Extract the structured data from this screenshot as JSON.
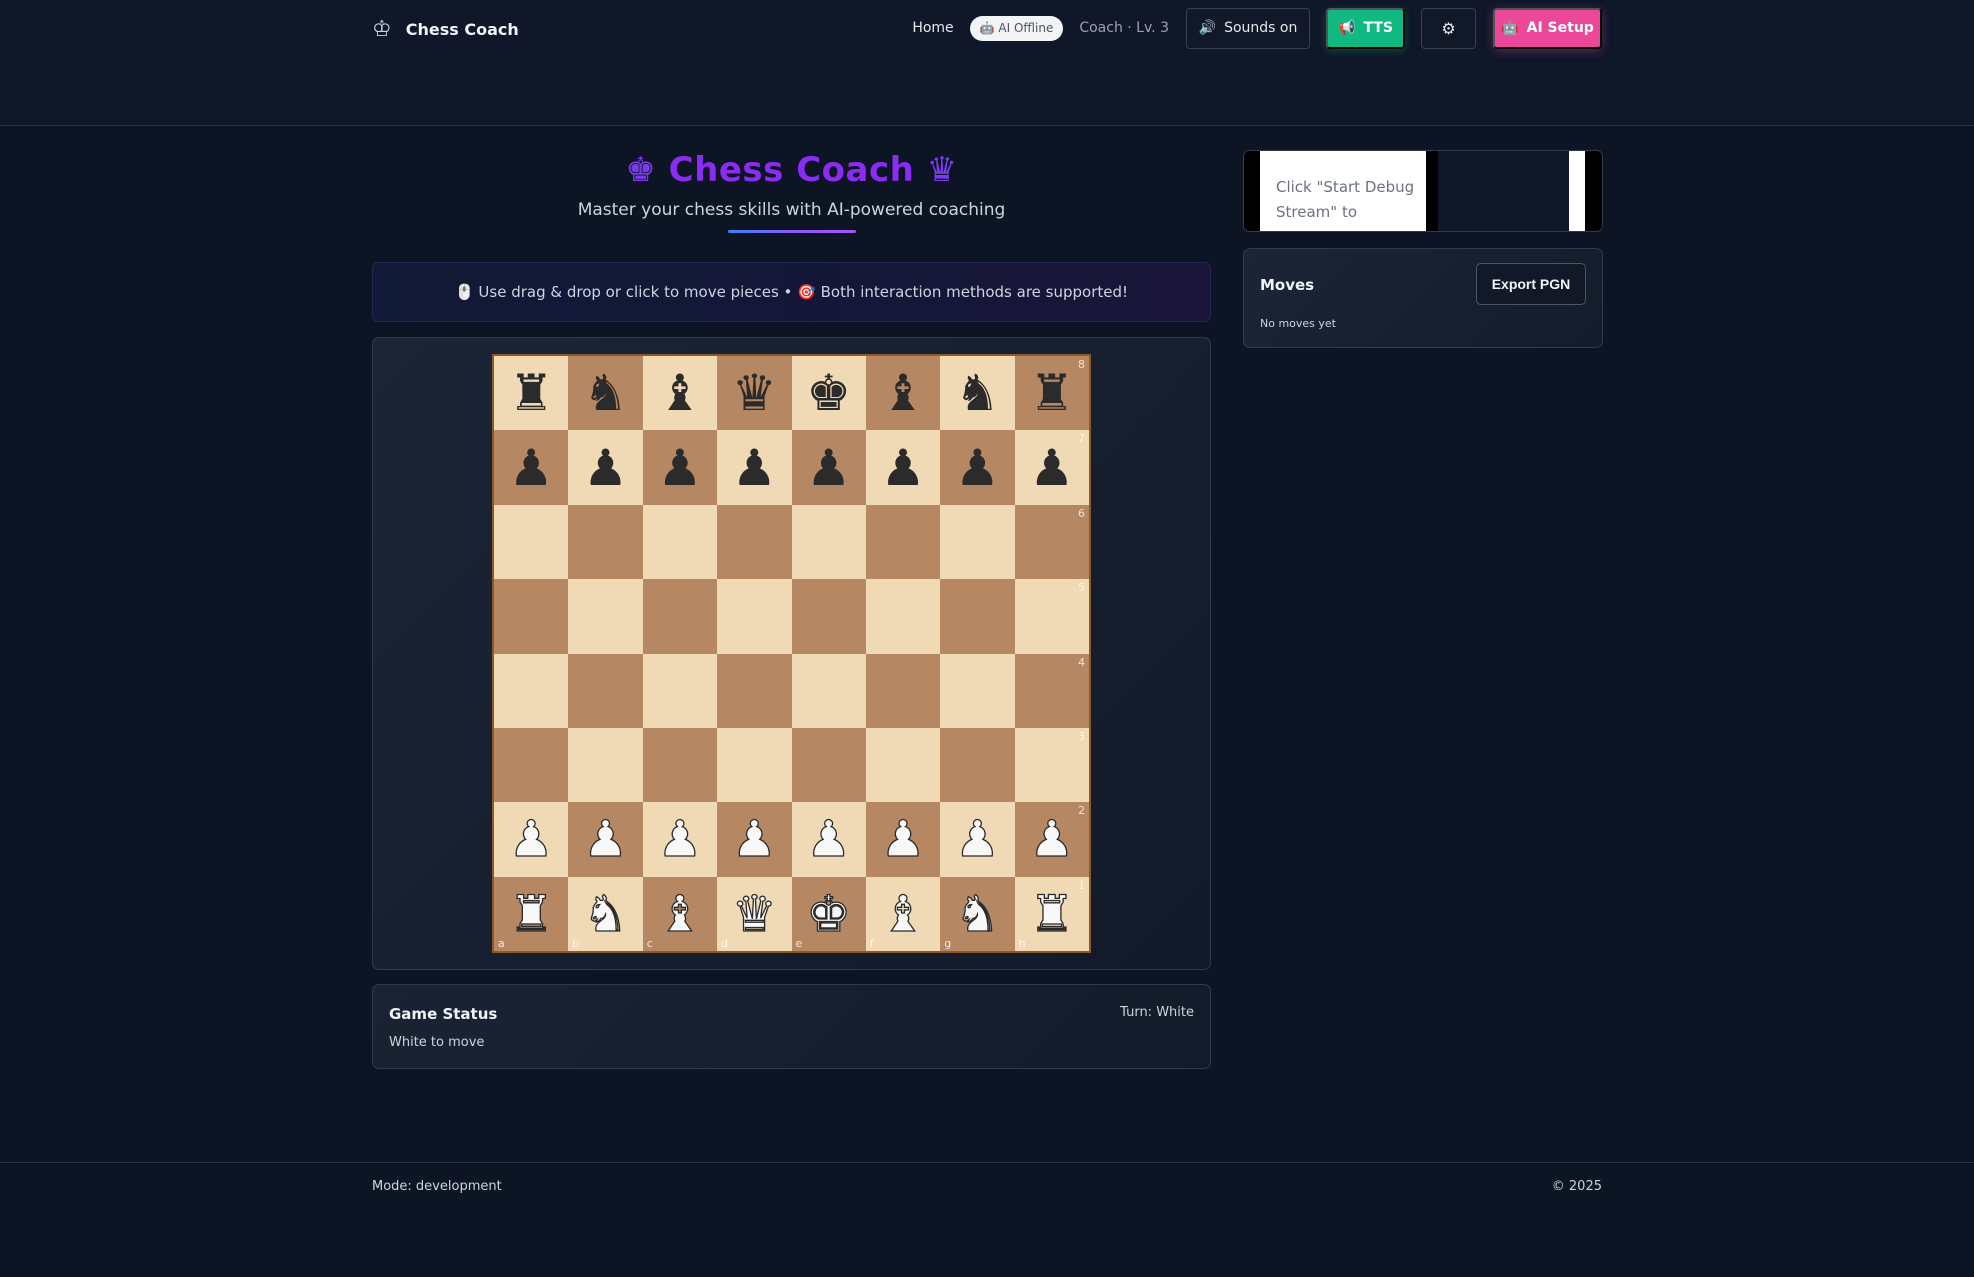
{
  "header": {
    "brand_icon": "♔",
    "brand_name": "Chess Coach",
    "home_label": "Home",
    "ai_status": "🤖 AI Offline",
    "coach_level": "Coach · Lv. 3",
    "sounds_icon": "🔊",
    "sounds_label": "Sounds on",
    "tts_icon": "📢",
    "tts_label": "TTS",
    "settings_icon": "⚙",
    "ai_setup_icon": "🤖",
    "ai_setup_label": "AI Setup"
  },
  "hero": {
    "crown_left": "♚",
    "title": "Chess Coach",
    "crown_right": "♛",
    "subtitle": "Master your chess skills with AI-powered coaching"
  },
  "hint": {
    "text": "🖱️ Use drag & drop or click to move pieces • 🎯 Both interaction methods are supported!"
  },
  "board": {
    "orientation": "white",
    "ranks": [
      "8",
      "7",
      "6",
      "5",
      "4",
      "3",
      "2",
      "1"
    ],
    "files": [
      "a",
      "b",
      "c",
      "d",
      "e",
      "f",
      "g",
      "h"
    ],
    "position": [
      [
        "bR",
        "bN",
        "bB",
        "bQ",
        "bK",
        "bB",
        "bN",
        "bR"
      ],
      [
        "bP",
        "bP",
        "bP",
        "bP",
        "bP",
        "bP",
        "bP",
        "bP"
      ],
      [
        "",
        "",
        "",
        "",
        "",
        "",
        "",
        ""
      ],
      [
        "",
        "",
        "",
        "",
        "",
        "",
        "",
        ""
      ],
      [
        "",
        "",
        "",
        "",
        "",
        "",
        "",
        ""
      ],
      [
        "",
        "",
        "",
        "",
        "",
        "",
        "",
        ""
      ],
      [
        "wP",
        "wP",
        "wP",
        "wP",
        "wP",
        "wP",
        "wP",
        "wP"
      ],
      [
        "wR",
        "wN",
        "wB",
        "wQ",
        "wK",
        "wB",
        "wN",
        "wR"
      ]
    ],
    "light_color": "#f0d9b5",
    "dark_color": "#b58863"
  },
  "status": {
    "title": "Game Status",
    "turn": "Turn: White",
    "message": "White to move"
  },
  "debug": {
    "text": "Click \"Start Debug Stream\" to"
  },
  "moves": {
    "title": "Moves",
    "export_label": "Export PGN",
    "empty_text": "No moves yet"
  },
  "footer": {
    "mode": "Mode: development",
    "copyright": "© 2025"
  },
  "colors": {
    "accent_purple": "#8b2cf5",
    "tts_green": "#10b981",
    "ai_setup_pink": "#ec4899"
  }
}
